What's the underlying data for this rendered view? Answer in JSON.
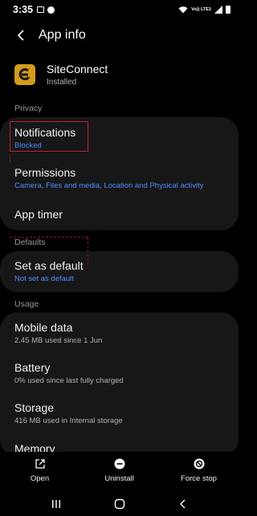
{
  "status_bar": {
    "time": "3:35",
    "network": "Vo)) LTE1"
  },
  "header": {
    "title": "App info"
  },
  "app": {
    "name": "SiteConnect",
    "status": "Installed"
  },
  "sections": {
    "privacy": "Privacy",
    "defaults": "Defaults",
    "usage": "Usage"
  },
  "rows": {
    "notifications": {
      "title": "Notifications",
      "subtitle": "Blocked"
    },
    "permissions": {
      "title": "Permissions",
      "subtitle": "Camera, Files and media, Location and Physical activity"
    },
    "app_timer": {
      "title": "App timer"
    },
    "set_as_default": {
      "title": "Set as default",
      "subtitle": "Not set as default"
    },
    "mobile_data": {
      "title": "Mobile data",
      "subtitle": "2.45 MB used since 1 Jun"
    },
    "battery": {
      "title": "Battery",
      "subtitle": "0% used since last fully charged"
    },
    "storage": {
      "title": "Storage",
      "subtitle": "416 MB used in Internal storage"
    },
    "memory": {
      "title": "Memory"
    }
  },
  "actions": {
    "open": "Open",
    "uninstall": "Uninstall",
    "force_stop": "Force stop"
  },
  "colors": {
    "accent_blue": "#4e8dff",
    "card": "#171717",
    "app_icon": "#d49a1c"
  },
  "icons": [
    "back-arrow-icon",
    "open-icon",
    "uninstall-icon",
    "force-stop-icon",
    "recents-icon",
    "home-icon",
    "nav-back-icon"
  ]
}
